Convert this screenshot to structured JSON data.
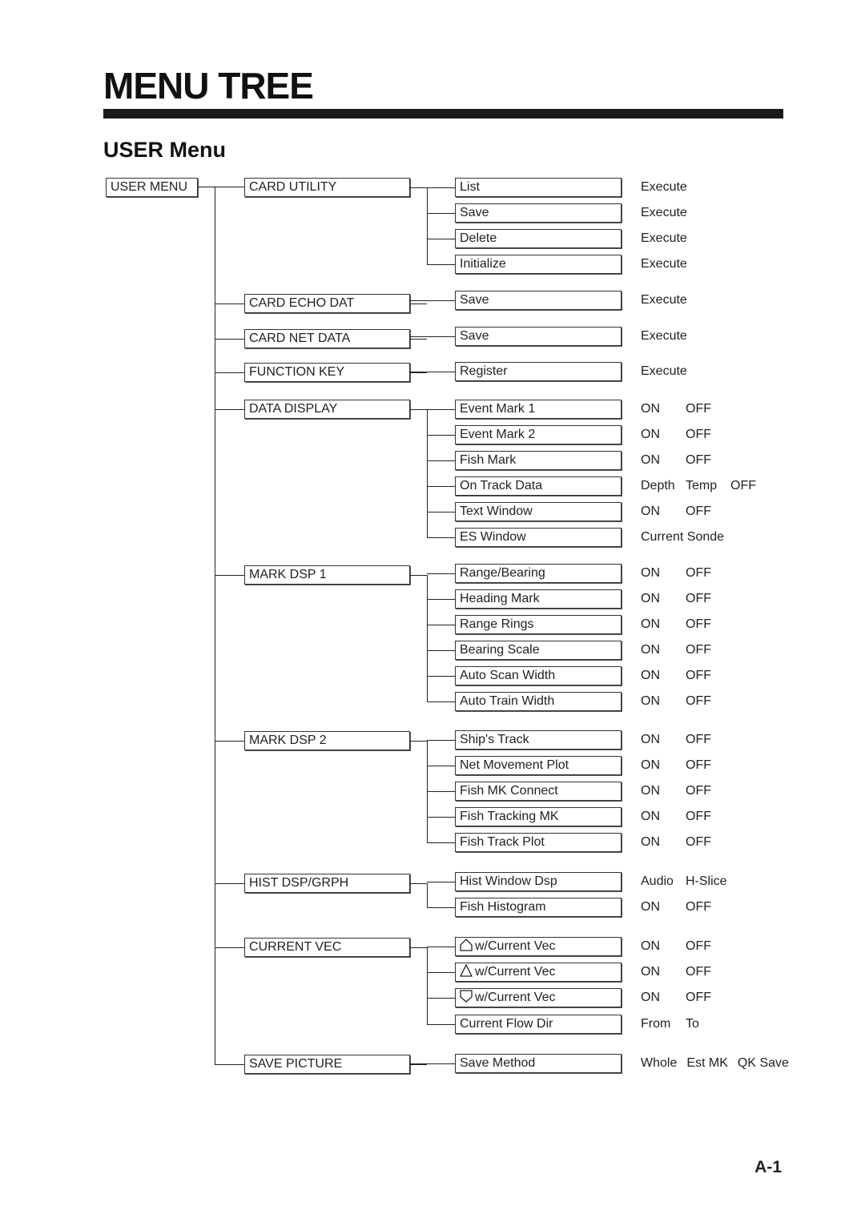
{
  "title": "MENU TREE",
  "subtitle": "USER Menu",
  "page_number": "A-1",
  "root": "USER MENU",
  "groups": [
    {
      "label": "CARD UTILITY",
      "items": [
        {
          "label": "List",
          "options": [
            "Execute"
          ]
        },
        {
          "label": "Save",
          "options": [
            "Execute"
          ]
        },
        {
          "label": "Delete",
          "options": [
            "Execute"
          ]
        },
        {
          "label": "Initialize",
          "options": [
            "Execute"
          ]
        }
      ]
    },
    {
      "label": "CARD ECHO DAT",
      "items": [
        {
          "label": "Save",
          "options": [
            "Execute"
          ]
        }
      ]
    },
    {
      "label": "CARD NET DATA",
      "items": [
        {
          "label": "Save",
          "options": [
            "Execute"
          ]
        }
      ]
    },
    {
      "label": "FUNCTION KEY",
      "items": [
        {
          "label": "Register",
          "options": [
            "Execute"
          ]
        }
      ]
    },
    {
      "label": "DATA DISPLAY",
      "items": [
        {
          "label": "Event Mark 1",
          "options": [
            "ON",
            "OFF"
          ]
        },
        {
          "label": "Event Mark 2",
          "options": [
            "ON",
            "OFF"
          ]
        },
        {
          "label": "Fish Mark",
          "options": [
            "ON",
            "OFF"
          ]
        },
        {
          "label": "On Track Data",
          "options": [
            "Depth",
            "Temp",
            "OFF"
          ]
        },
        {
          "label": "Text Window",
          "options": [
            "ON",
            "OFF"
          ]
        },
        {
          "label": "ES Window",
          "options": [
            "Current Sonde"
          ]
        }
      ]
    },
    {
      "label": "MARK DSP 1",
      "items": [
        {
          "label": "Range/Bearing",
          "options": [
            "ON",
            "OFF"
          ]
        },
        {
          "label": "Heading Mark",
          "options": [
            "ON",
            "OFF"
          ]
        },
        {
          "label": "Range Rings",
          "options": [
            "ON",
            "OFF"
          ]
        },
        {
          "label": "Bearing Scale",
          "options": [
            "ON",
            "OFF"
          ]
        },
        {
          "label": "Auto Scan Width",
          "options": [
            "ON",
            "OFF"
          ]
        },
        {
          "label": "Auto Train Width",
          "options": [
            "ON",
            "OFF"
          ]
        }
      ]
    },
    {
      "label": "MARK DSP 2",
      "items": [
        {
          "label": "Ship's Track",
          "options": [
            "ON",
            "OFF"
          ]
        },
        {
          "label": "Net Movement Plot",
          "options": [
            "ON",
            "OFF"
          ]
        },
        {
          "label": "Fish MK Connect",
          "options": [
            "ON",
            "OFF"
          ]
        },
        {
          "label": "Fish Tracking MK",
          "options": [
            "ON",
            "OFF"
          ]
        },
        {
          "label": "Fish Track Plot",
          "options": [
            "ON",
            "OFF"
          ]
        }
      ]
    },
    {
      "label": "HIST DSP/GRPH",
      "items": [
        {
          "label": "Hist Window Dsp",
          "options": [
            "Audio",
            "H-Slice"
          ]
        },
        {
          "label": "Fish Histogram",
          "options": [
            "ON",
            "OFF"
          ]
        }
      ]
    },
    {
      "label": "CURRENT VEC",
      "items": [
        {
          "label": "w/Current Vec",
          "icon": "house-shape-icon",
          "options": [
            "ON",
            "OFF"
          ]
        },
        {
          "label": "w/Current Vec",
          "icon": "triangle-icon",
          "options": [
            "ON",
            "OFF"
          ]
        },
        {
          "label": "w/Current Vec",
          "icon": "shield-shape-icon",
          "options": [
            "ON",
            "OFF"
          ]
        },
        {
          "label": "Current Flow Dir",
          "options": [
            "From",
            "To"
          ]
        }
      ]
    },
    {
      "label": "SAVE PICTURE",
      "items": [
        {
          "label": "Save Method",
          "options": [
            "Whole",
            "Est MK",
            "QK Save"
          ]
        }
      ]
    }
  ]
}
